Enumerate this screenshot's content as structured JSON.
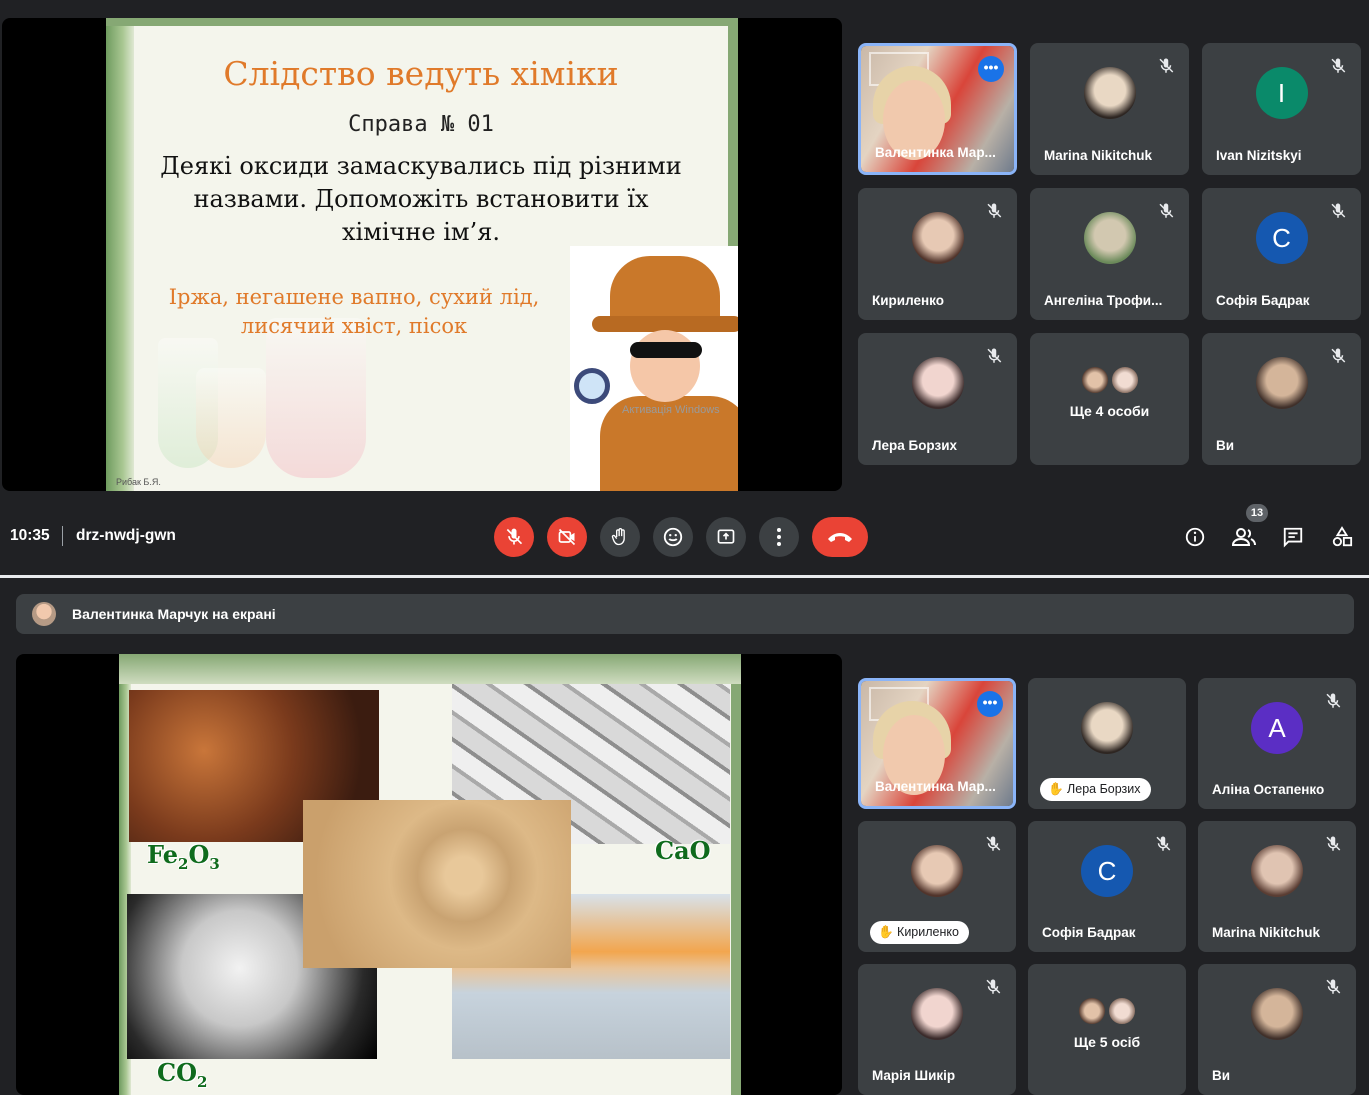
{
  "top": {
    "slide": {
      "title": "Слідство ведуть хіміки",
      "case": "Справа № 01",
      "body": "Деякі оксиди замаскувались під різними назвами. Допоможіть встановити їх хімічне ім’я.",
      "clue": "Іржа, негашене вапно, сухий лід, лисячий хвіст, пісок",
      "watermark": "Активація Windows",
      "author": "Рибак Б.Я."
    },
    "participants": [
      {
        "name": "Валентинка Мар...",
        "type": "video",
        "active": true
      },
      {
        "name": "Marina Nikitchuk",
        "type": "photo",
        "muted": true
      },
      {
        "name": "Ivan Nizitskyi",
        "type": "letter",
        "letter": "I",
        "color": "#0a8a6a",
        "muted": true
      },
      {
        "name": "Кириленко",
        "type": "photo",
        "muted": true
      },
      {
        "name": "Ангеліна Трофи...",
        "type": "photo",
        "muted": true
      },
      {
        "name": "Софія Бадрак",
        "type": "letter",
        "letter": "C",
        "color": "#1558b0",
        "muted": true
      },
      {
        "name": "Лера Борзих",
        "type": "photo",
        "muted": true
      },
      {
        "name": "Ще 4 особи",
        "type": "more"
      },
      {
        "name": "Ви",
        "type": "photo",
        "muted": true
      }
    ],
    "controls": {
      "time": "10:35",
      "meeting_code": "drz-nwdj-gwn",
      "people_count": "13"
    }
  },
  "bottom": {
    "banner": "Валентинка Марчук на екрані",
    "slide": {
      "formulas": {
        "rust": "Fe",
        "rust_sub1": "2",
        "rust_o": "O",
        "rust_sub2": "3",
        "lime": "CaO",
        "ice": "CO",
        "ice_sub": "2"
      }
    },
    "participants": [
      {
        "name": "Валентинка Мар...",
        "type": "video",
        "active": true
      },
      {
        "name": "Лера Борзих",
        "type": "photo",
        "pill": true
      },
      {
        "name": "Аліна Остапенко",
        "type": "letter",
        "letter": "A",
        "color": "#5b2ec4",
        "muted": true
      },
      {
        "name": "Кириленко",
        "type": "photo",
        "pill": true,
        "muted": true
      },
      {
        "name": "Софія Бадрак",
        "type": "letter",
        "letter": "C",
        "color": "#1558b0",
        "muted": true
      },
      {
        "name": "Marina Nikitchuk",
        "type": "photo",
        "muted": true
      },
      {
        "name": "Марія Шикір",
        "type": "photo",
        "muted": true
      },
      {
        "name": "Ще 5 осіб",
        "type": "more"
      },
      {
        "name": "Ви",
        "type": "photo",
        "muted": true
      }
    ]
  }
}
